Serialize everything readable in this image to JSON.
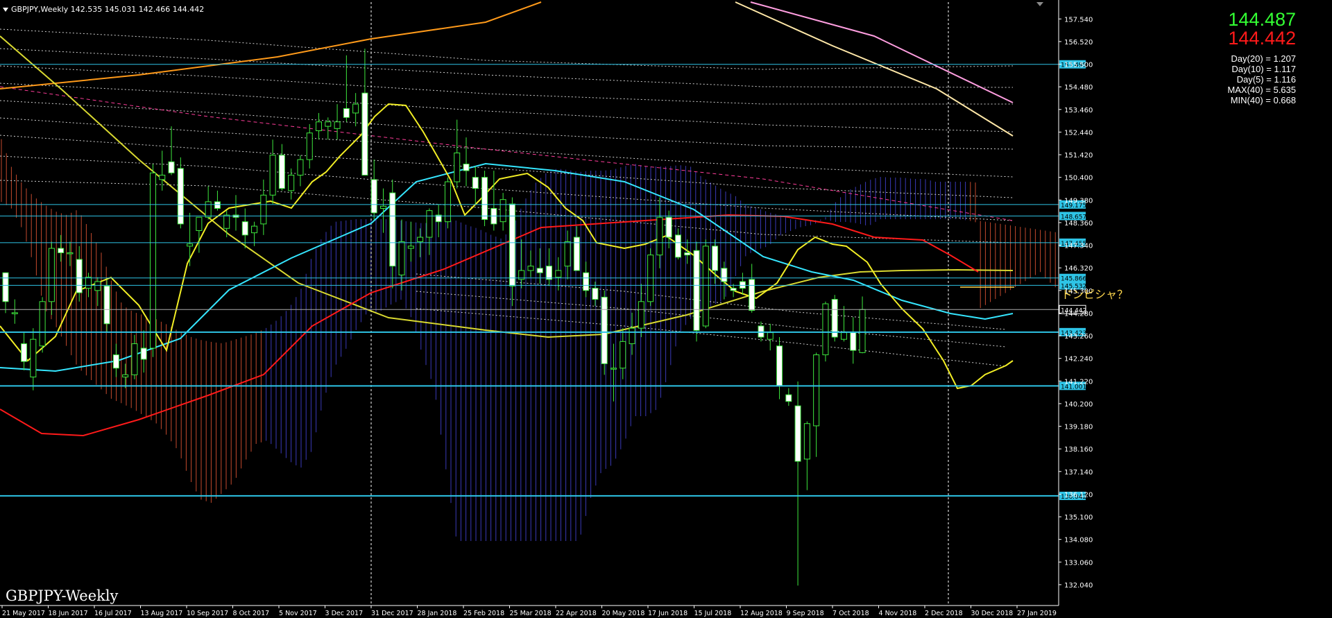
{
  "header": {
    "text": "GBPJPY,Weekly  142.535 145.031 142.466 144.442"
  },
  "watermark": "GBPJPY-Weekly",
  "prices": {
    "ask": "144.487",
    "bid": "144.442"
  },
  "stats": [
    "Day(20) = 1.207",
    "Day(10) = 1.117",
    "Day(5) = 1.116",
    "MAX(40) = 5.635",
    "MIN(40) = 0.668"
  ],
  "annotation": "ドンピシャ？",
  "chart_data": {
    "type": "candlestick",
    "instrument": "GBPJPY",
    "timeframe": "Weekly",
    "ylim": [
      131.1,
      158.3
    ],
    "ytick_labels": [
      "157.540",
      "156.520",
      "155.500",
      "154.480",
      "153.460",
      "152.440",
      "151.420",
      "150.400",
      "149.380",
      "148.360",
      "147.340",
      "146.320",
      "145.300",
      "144.280",
      "143.260",
      "142.240",
      "141.220",
      "140.200",
      "139.180",
      "138.160",
      "137.140",
      "136.120",
      "135.100",
      "134.080",
      "133.060",
      "132.040"
    ],
    "x_labels": [
      "21 May 2017",
      "18 Jun 2017",
      "16 Jul 2017",
      "13 Aug 2017",
      "10 Sep 2017",
      "8 Oct 2017",
      "5 Nov 2017",
      "3 Dec 2017",
      "31 Dec 2017",
      "28 Jan 2018",
      "25 Feb 2018",
      "25 Mar 2018",
      "22 Apr 2018",
      "20 May 2018",
      "17 Jun 2018",
      "15 Jul 2018",
      "12 Aug 2018",
      "9 Sep 2018",
      "7 Oct 2018",
      "4 Nov 2018",
      "2 Dec 2018",
      "30 Dec 2018",
      "27 Jan 2019"
    ],
    "candles": [
      [
        146.1,
        146.0,
        144.28,
        144.8
      ],
      [
        144.25,
        144.9,
        143.8,
        144.3
      ],
      [
        142.9,
        143.4,
        141.7,
        142.1
      ],
      [
        141.4,
        143.6,
        140.8,
        143.1
      ],
      [
        142.8,
        145.0,
        142.5,
        144.8
      ],
      [
        144.8,
        147.5,
        144.2,
        147.2
      ],
      [
        147.2,
        147.8,
        146.6,
        147.0
      ],
      [
        147.0,
        147.5,
        146.4,
        147.0
      ],
      [
        146.7,
        147.3,
        144.8,
        145.2
      ],
      [
        145.4,
        146.1,
        145.0,
        145.9
      ],
      [
        145.3,
        145.9,
        144.6,
        145.7
      ],
      [
        145.5,
        145.8,
        143.4,
        143.8
      ],
      [
        142.4,
        142.9,
        141.4,
        141.8
      ],
      [
        141.4,
        142.0,
        140.9,
        141.5
      ],
      [
        141.5,
        143.3,
        141.3,
        142.9
      ],
      [
        142.7,
        143.5,
        141.6,
        142.2
      ],
      [
        142.7,
        151.0,
        142.3,
        150.6
      ],
      [
        150.3,
        151.6,
        149.8,
        150.5
      ],
      [
        151.1,
        152.7,
        150.5,
        150.6
      ],
      [
        150.8,
        151.3,
        148.1,
        148.3
      ],
      [
        147.3,
        148.8,
        146.4,
        147.4
      ],
      [
        148.0,
        148.6,
        147.0,
        148.6
      ],
      [
        148.6,
        150.0,
        148.5,
        149.3
      ],
      [
        149.3,
        149.8,
        148.9,
        149.0
      ],
      [
        148.1,
        148.9,
        147.7,
        148.7
      ],
      [
        148.7,
        149.6,
        148.0,
        148.6
      ],
      [
        148.4,
        149.0,
        147.2,
        147.8
      ],
      [
        147.9,
        148.4,
        147.3,
        148.2
      ],
      [
        148.3,
        150.3,
        147.8,
        149.6
      ],
      [
        149.6,
        152.1,
        149.2,
        151.4
      ],
      [
        151.4,
        151.9,
        149.8,
        149.9
      ],
      [
        149.8,
        150.8,
        149.4,
        150.5
      ],
      [
        150.5,
        151.4,
        150.0,
        151.2
      ],
      [
        151.2,
        152.8,
        150.8,
        152.4
      ],
      [
        152.5,
        153.3,
        152.1,
        152.9
      ],
      [
        152.7,
        153.1,
        152.1,
        152.9
      ],
      [
        152.6,
        153.7,
        152.1,
        152.9
      ],
      [
        153.5,
        155.9,
        152.9,
        153.1
      ],
      [
        153.3,
        154.2,
        152.7,
        153.7
      ],
      [
        154.2,
        156.2,
        152.8,
        150.5
      ],
      [
        150.3,
        151.2,
        148.5,
        148.8
      ],
      [
        149.0,
        149.9,
        147.9,
        149.1
      ],
      [
        149.7,
        150.3,
        145.4,
        146.4
      ],
      [
        146.0,
        148.5,
        145.3,
        147.5
      ],
      [
        147.2,
        148.4,
        146.6,
        147.3
      ],
      [
        147.5,
        148.1,
        146.8,
        147.7
      ],
      [
        147.7,
        149.0,
        146.9,
        148.9
      ],
      [
        148.7,
        149.2,
        147.7,
        148.4
      ],
      [
        148.4,
        150.4,
        148.1,
        150.2
      ],
      [
        150.2,
        153.0,
        149.9,
        151.5
      ],
      [
        151.0,
        152.2,
        150.0,
        150.7
      ],
      [
        150.4,
        150.9,
        149.2,
        149.9
      ],
      [
        150.4,
        150.7,
        148.2,
        148.5
      ],
      [
        149.0,
        150.7,
        148.0,
        148.3
      ],
      [
        148.4,
        149.7,
        148.0,
        149.4
      ],
      [
        149.2,
        149.5,
        144.6,
        145.5
      ],
      [
        145.8,
        147.6,
        145.4,
        146.2
      ],
      [
        146.2,
        147.1,
        145.9,
        146.4
      ],
      [
        146.3,
        147.2,
        145.6,
        146.1
      ],
      [
        146.4,
        147.2,
        145.5,
        145.8
      ],
      [
        145.9,
        146.8,
        145.3,
        146.2
      ],
      [
        146.4,
        148.0,
        145.8,
        147.5
      ],
      [
        147.7,
        148.2,
        146.2,
        146.2
      ],
      [
        146.1,
        146.6,
        145.0,
        145.3
      ],
      [
        145.4,
        145.7,
        144.6,
        144.9
      ],
      [
        145.0,
        145.3,
        141.5,
        142.0
      ],
      [
        141.8,
        142.9,
        140.3,
        141.8
      ],
      [
        141.8,
        143.6,
        141.3,
        143.0
      ],
      [
        142.9,
        144.3,
        142.4,
        143.6
      ],
      [
        143.6,
        145.6,
        143.2,
        144.8
      ],
      [
        144.8,
        147.2,
        144.6,
        146.9
      ],
      [
        146.9,
        149.5,
        146.3,
        148.6
      ],
      [
        148.6,
        148.9,
        147.2,
        147.7
      ],
      [
        147.8,
        148.1,
        146.7,
        146.8
      ],
      [
        147.0,
        147.6,
        146.5,
        146.9
      ],
      [
        147.1,
        147.5,
        143.0,
        143.5
      ],
      [
        143.7,
        147.6,
        143.6,
        147.3
      ],
      [
        147.3,
        147.6,
        145.6,
        146.2
      ],
      [
        146.3,
        146.6,
        144.9,
        145.7
      ],
      [
        145.4,
        145.6,
        145.0,
        145.3
      ],
      [
        145.7,
        146.1,
        145.1,
        145.4
      ],
      [
        145.8,
        146.5,
        144.3,
        144.4
      ],
      [
        143.7,
        143.9,
        143.0,
        143.2
      ],
      [
        143.1,
        143.8,
        142.6,
        143.4
      ],
      [
        142.8,
        143.2,
        140.4,
        141.0
      ],
      [
        140.6,
        140.9,
        140.1,
        140.3
      ],
      [
        140.1,
        141.2,
        132.0,
        137.6
      ],
      [
        137.7,
        139.4,
        136.3,
        139.3
      ],
      [
        139.2,
        142.5,
        137.8,
        142.4
      ],
      [
        142.4,
        144.8,
        142.1,
        144.7
      ],
      [
        144.9,
        145.1,
        143.0,
        143.2
      ],
      [
        143.1,
        144.6,
        143.0,
        143.4
      ],
      [
        143.4,
        144.1,
        142.0,
        142.6
      ],
      [
        142.5,
        145.03,
        142.47,
        144.44
      ]
    ],
    "horizontal_levels": [
      "155.495",
      "149.175",
      "148.657",
      "147.455",
      "145.866",
      "145.532",
      "144.442",
      "143.423",
      "141.001",
      "136.042"
    ]
  }
}
